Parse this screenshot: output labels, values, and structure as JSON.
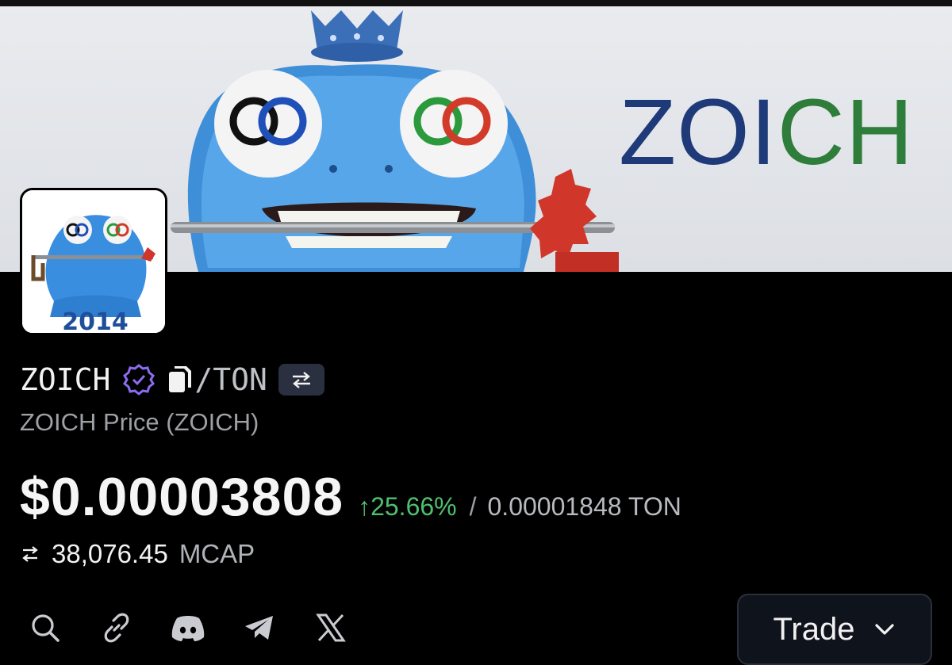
{
  "banner": {
    "title_part1": "ZOI",
    "title_part2": "CH",
    "avatar_year": "2014"
  },
  "token": {
    "name": "ZOICH",
    "pair_suffix": "/TON",
    "subtitle": "ZOICH Price (ZOICH)"
  },
  "price": {
    "usd": "$0.00003808",
    "change": "25.66%",
    "change_direction": "up",
    "separator": "/",
    "ton": "0.00001848 TON"
  },
  "mcap": {
    "value": "38,076.45",
    "label": "MCAP"
  },
  "socials": [
    {
      "icon": "search-icon"
    },
    {
      "icon": "link-icon"
    },
    {
      "icon": "discord-icon"
    },
    {
      "icon": "telegram-icon"
    },
    {
      "icon": "x-icon"
    }
  ],
  "trade_button": {
    "label": "Trade"
  },
  "colors": {
    "positive": "#4fbf6f",
    "verified": "#8b6cf0",
    "background": "#000000"
  }
}
